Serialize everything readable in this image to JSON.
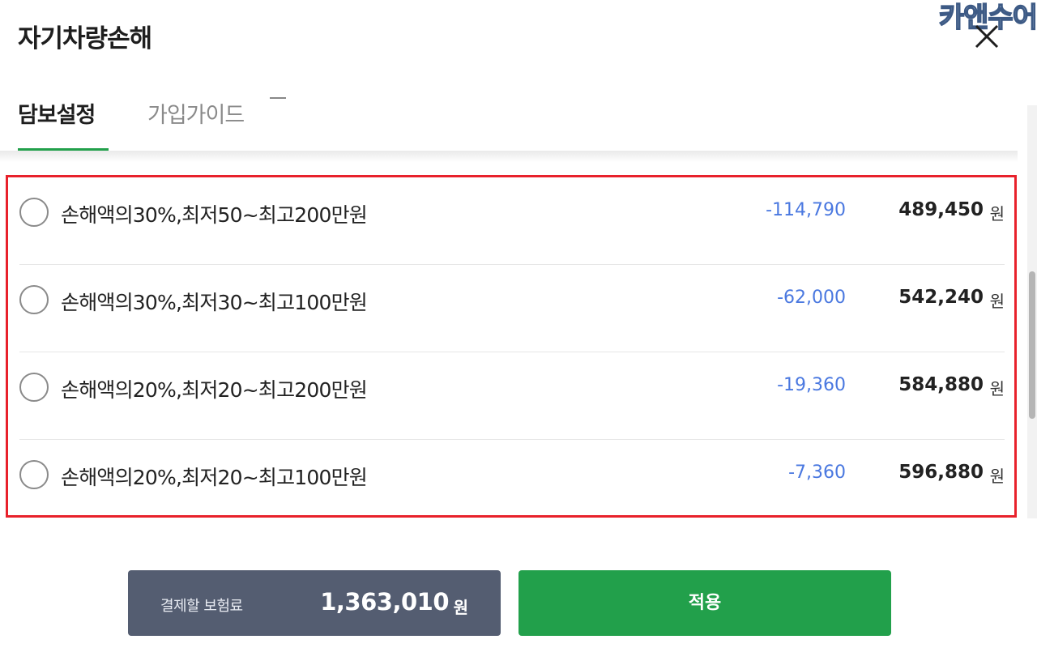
{
  "header": {
    "title": "자기차량손해",
    "watermark": "카앤수어",
    "close_icon": "close-icon"
  },
  "tabs": [
    {
      "label": "담보설정",
      "active": true
    },
    {
      "label": "가입가이드",
      "active": false
    }
  ],
  "options": [
    {
      "label": "손해액의30%,최저50~최고200만원",
      "diff": "-114,790",
      "price": "489,450",
      "unit": "원"
    },
    {
      "label": "손해액의30%,최저30~최고100만원",
      "diff": "-62,000",
      "price": "542,240",
      "unit": "원"
    },
    {
      "label": "손해액의20%,최저20~최고200만원",
      "diff": "-19,360",
      "price": "584,880",
      "unit": "원"
    },
    {
      "label": "손해액의20%,최저20~최고100만원",
      "diff": "-7,360",
      "price": "596,880",
      "unit": "원"
    }
  ],
  "footer": {
    "total_label": "결제할 보험료",
    "total_value": "1,363,010",
    "total_unit": "원",
    "apply_label": "적용"
  },
  "colors": {
    "accent": "#22a04b",
    "diff_blue": "#4a78e0",
    "highlight_border": "#e8212b",
    "total_bg": "#545d71"
  }
}
